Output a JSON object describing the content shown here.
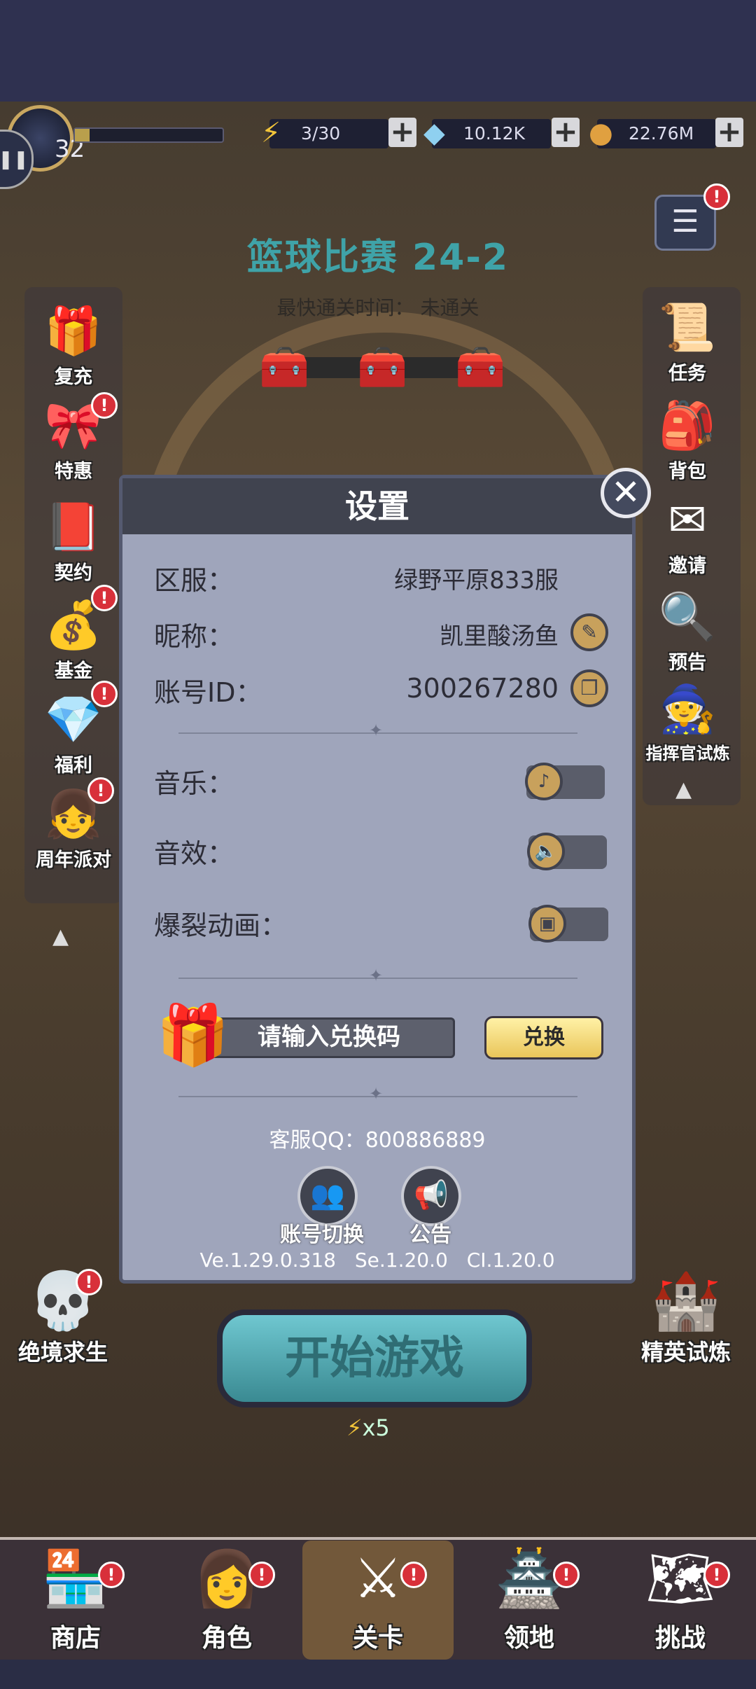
{
  "hud": {
    "level": "32",
    "exp_progress": 0.1,
    "energy": "3/30",
    "diamonds": "10.12K",
    "gold": "22.76M",
    "plus": "+"
  },
  "stage": {
    "title": "篮球比赛 24-2",
    "fastest_label": "最快通关时间：",
    "fastest_value": "未通关"
  },
  "left_menu": [
    {
      "label": "复充",
      "icon": "gift-box-icon",
      "badge": false
    },
    {
      "label": "特惠",
      "icon": "deal-icon",
      "badge": true
    },
    {
      "label": "契约",
      "icon": "contract-icon",
      "badge": false
    },
    {
      "label": "基金",
      "icon": "fund-icon",
      "badge": true
    },
    {
      "label": "福利",
      "icon": "welfare-icon",
      "badge": true
    },
    {
      "label": "周年派对",
      "icon": "anniversary-icon",
      "badge": true
    }
  ],
  "right_menu": [
    {
      "label": "任务",
      "icon": "quest-icon",
      "badge": false
    },
    {
      "label": "背包",
      "icon": "backpack-icon",
      "badge": false
    },
    {
      "label": "邀请",
      "icon": "invite-icon",
      "badge": false
    },
    {
      "label": "预告",
      "icon": "preview-icon",
      "badge": false
    },
    {
      "label": "指挥官试炼",
      "icon": "commander-trial-icon",
      "badge": false
    }
  ],
  "settings": {
    "title": "设置",
    "server_label": "区服：",
    "server_value": "绿野平原833服",
    "nickname_label": "昵称：",
    "nickname_value": "凯里酸汤鱼",
    "account_label": "账号ID：",
    "account_value": "300267280",
    "music_label": "音乐：",
    "sfx_label": "音效：",
    "burst_label": "爆裂动画：",
    "code_placeholder": "请输入兑换码",
    "redeem_label": "兑换",
    "cs_text": "客服QQ：800886889",
    "switch_account_label": "账号切换",
    "announcement_label": "公告",
    "versions": "Ve.1.29.0.318 Se.1.20.0 CI.1.20.0",
    "close": "✕"
  },
  "bottom": {
    "start_label": "开始游戏",
    "energy_cost": "x5",
    "left_big_label": "绝境求生",
    "right_big_label": "精英试炼"
  },
  "tabs": [
    {
      "label": "商店",
      "icon": "shop-icon",
      "badge": true
    },
    {
      "label": "角色",
      "icon": "character-icon",
      "badge": true
    },
    {
      "label": "关卡",
      "icon": "stage-icon",
      "badge": true,
      "active": true
    },
    {
      "label": "领地",
      "icon": "territory-icon",
      "badge": true
    },
    {
      "label": "挑战",
      "icon": "challenge-icon",
      "badge": true
    }
  ]
}
